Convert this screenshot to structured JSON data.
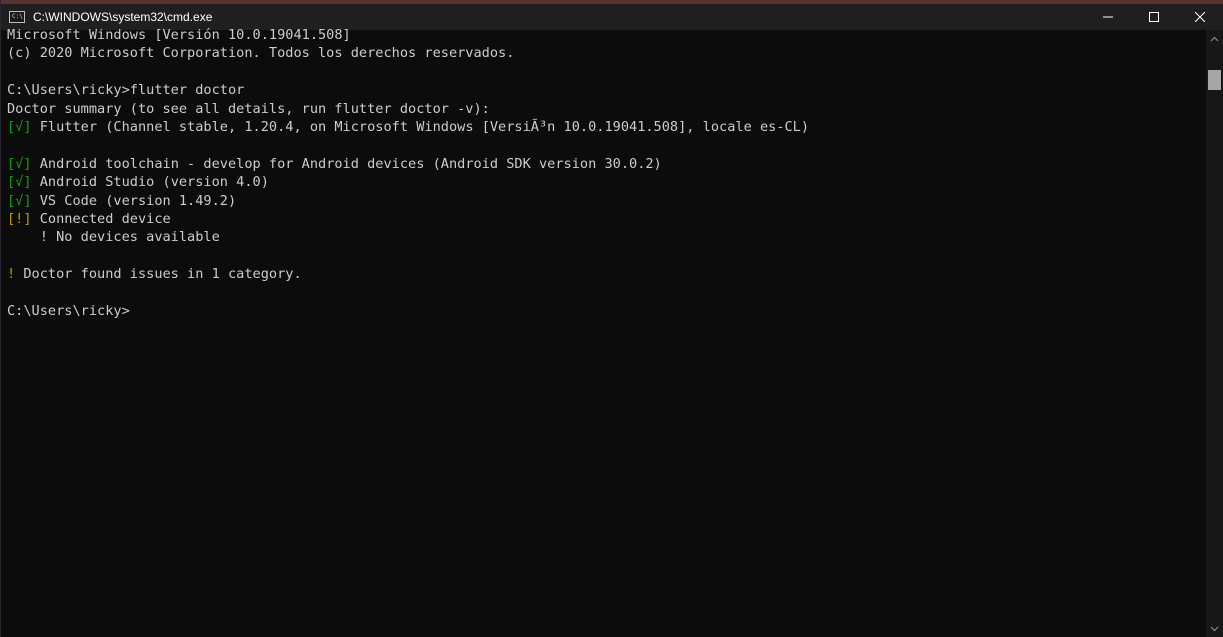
{
  "window": {
    "title": "C:\\WINDOWS\\system32\\cmd.exe",
    "icon_label": "C:\\",
    "controls": [
      "minimize-icon",
      "maximize-icon",
      "close-icon"
    ]
  },
  "terminal": {
    "lines": [
      {
        "parts": [
          {
            "text": "Microsoft Windows [Versión 10.0.19041.508]",
            "color": "default"
          }
        ]
      },
      {
        "parts": [
          {
            "text": "(c) 2020 Microsoft Corporation. Todos los derechos reservados.",
            "color": "default"
          }
        ]
      },
      {
        "parts": [
          {
            "text": "",
            "color": "default"
          }
        ]
      },
      {
        "parts": [
          {
            "text": "C:\\Users\\ricky>flutter doctor",
            "color": "default"
          }
        ]
      },
      {
        "parts": [
          {
            "text": "Doctor summary (to see all details, run flutter doctor -v):",
            "color": "default"
          }
        ]
      },
      {
        "parts": [
          {
            "text": "[√]",
            "color": "green"
          },
          {
            "text": " Flutter (Channel stable, 1.20.4, on Microsoft Windows [VersiÃ³n 10.0.19041.508], locale es-CL)",
            "color": "default"
          }
        ]
      },
      {
        "parts": [
          {
            "text": "",
            "color": "default"
          }
        ]
      },
      {
        "parts": [
          {
            "text": "[√]",
            "color": "green"
          },
          {
            "text": " Android toolchain - develop for Android devices (Android SDK version 30.0.2)",
            "color": "default"
          }
        ]
      },
      {
        "parts": [
          {
            "text": "[√]",
            "color": "green"
          },
          {
            "text": " Android Studio (version 4.0)",
            "color": "default"
          }
        ]
      },
      {
        "parts": [
          {
            "text": "[√]",
            "color": "green"
          },
          {
            "text": " VS Code (version 1.49.2)",
            "color": "default"
          }
        ]
      },
      {
        "parts": [
          {
            "text": "[!]",
            "color": "yellow"
          },
          {
            "text": " Connected device",
            "color": "default"
          }
        ]
      },
      {
        "parts": [
          {
            "text": "    ! No devices available",
            "color": "default"
          }
        ]
      },
      {
        "parts": [
          {
            "text": "",
            "color": "default"
          }
        ]
      },
      {
        "parts": [
          {
            "text": "!",
            "color": "yellow"
          },
          {
            "text": " Doctor found issues in 1 category.",
            "color": "default"
          }
        ]
      },
      {
        "parts": [
          {
            "text": "",
            "color": "default"
          }
        ]
      },
      {
        "parts": [
          {
            "text": "C:\\Users\\ricky>",
            "color": "default"
          }
        ]
      }
    ]
  },
  "colors": {
    "background": "#0c0c0c",
    "text": "#cccccc",
    "green": "#13a10e",
    "yellow": "#c19c00"
  }
}
